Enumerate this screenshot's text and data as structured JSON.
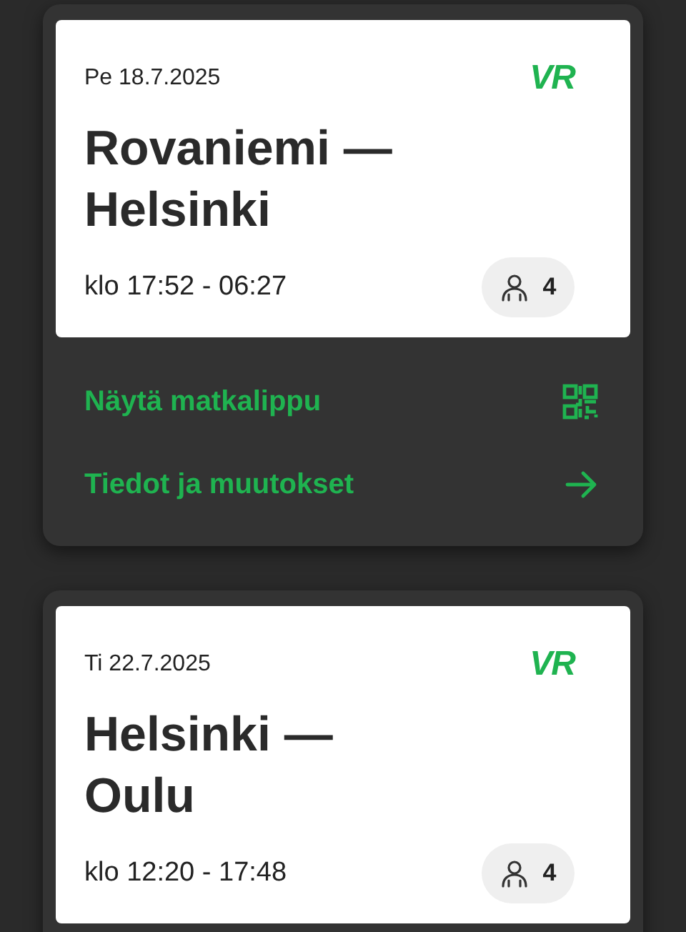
{
  "trips": [
    {
      "date": "Pe 18.7.2025",
      "logo": "VR",
      "route": [
        "Rovaniemi —",
        "Helsinki"
      ],
      "time": "klo 17:52 - 06:27",
      "passengers": "4",
      "actions": [
        {
          "kind": "ticket",
          "label": "Näytä matkalippu"
        },
        {
          "kind": "details",
          "label": "Tiedot ja muutokset"
        }
      ]
    },
    {
      "date": "Ti 22.7.2025",
      "logo": "VR",
      "route": [
        "Helsinki —",
        "Oulu"
      ],
      "time": "klo 12:20 - 17:48",
      "passengers": "4"
    }
  ]
}
